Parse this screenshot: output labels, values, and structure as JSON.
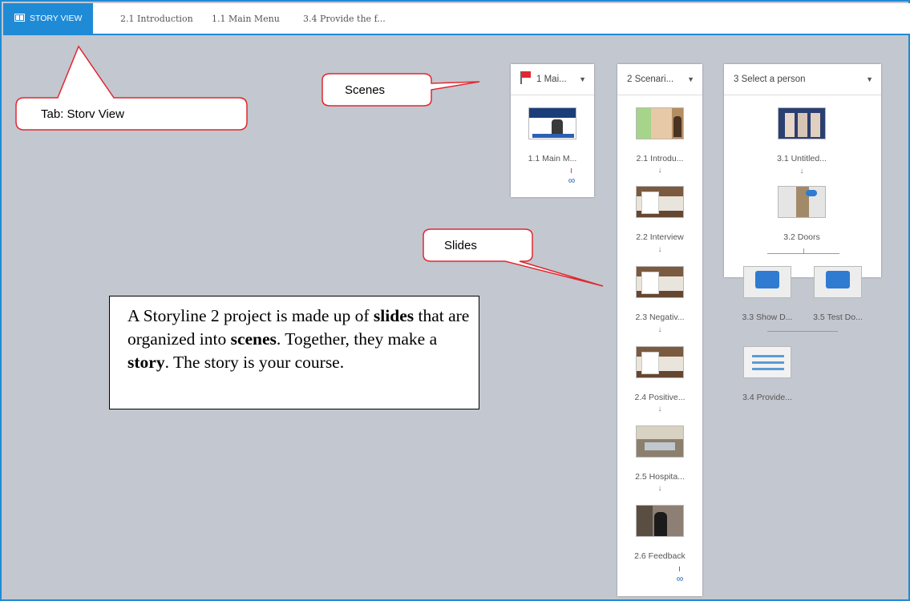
{
  "tabs": [
    {
      "label": "STORY VIEW",
      "active": true,
      "icon": "story-view-icon"
    },
    {
      "label": "2.1 Introduction"
    },
    {
      "label": "1.1 Main Menu"
    },
    {
      "label": "3.4 Provide the f..."
    }
  ],
  "scenes": [
    {
      "title": "1 Mai...",
      "icon": "flag-icon",
      "slides": [
        {
          "label": "1.1 Main M..."
        }
      ],
      "link_icon": "link-icon"
    },
    {
      "title": "2 Scenari...",
      "slides": [
        {
          "label": "2.1 Introdu..."
        },
        {
          "label": "2.2 Interview"
        },
        {
          "label": "2.3 Negativ..."
        },
        {
          "label": "2.4 Positive..."
        },
        {
          "label": "2.5 Hospita..."
        },
        {
          "label": "2.6 Feedback"
        }
      ],
      "link_icon": "link-icon"
    },
    {
      "title": "3 Select a person",
      "slides": [
        {
          "label": "3.1 Untitled..."
        },
        {
          "label": "3.2 Doors"
        },
        {
          "label": "3.3 Show D..."
        },
        {
          "label": "3.5 Test Do..."
        },
        {
          "label": "3.4 Provide..."
        }
      ]
    }
  ],
  "callouts": {
    "story_view": "Tab: Storv View",
    "scenes": "Scenes",
    "slides": "Slides"
  },
  "description": {
    "t1": "A Storyline 2 project is made up of ",
    "b1": "slides",
    "t2": " that are organized into ",
    "b2": "scenes",
    "t3": ".  Together, they make a ",
    "b3": "story",
    "t4": ".  The story is your course."
  },
  "colors": {
    "accent": "#1f8bd6",
    "canvas": "#c3c7cf",
    "callout_border": "#e0282f"
  }
}
